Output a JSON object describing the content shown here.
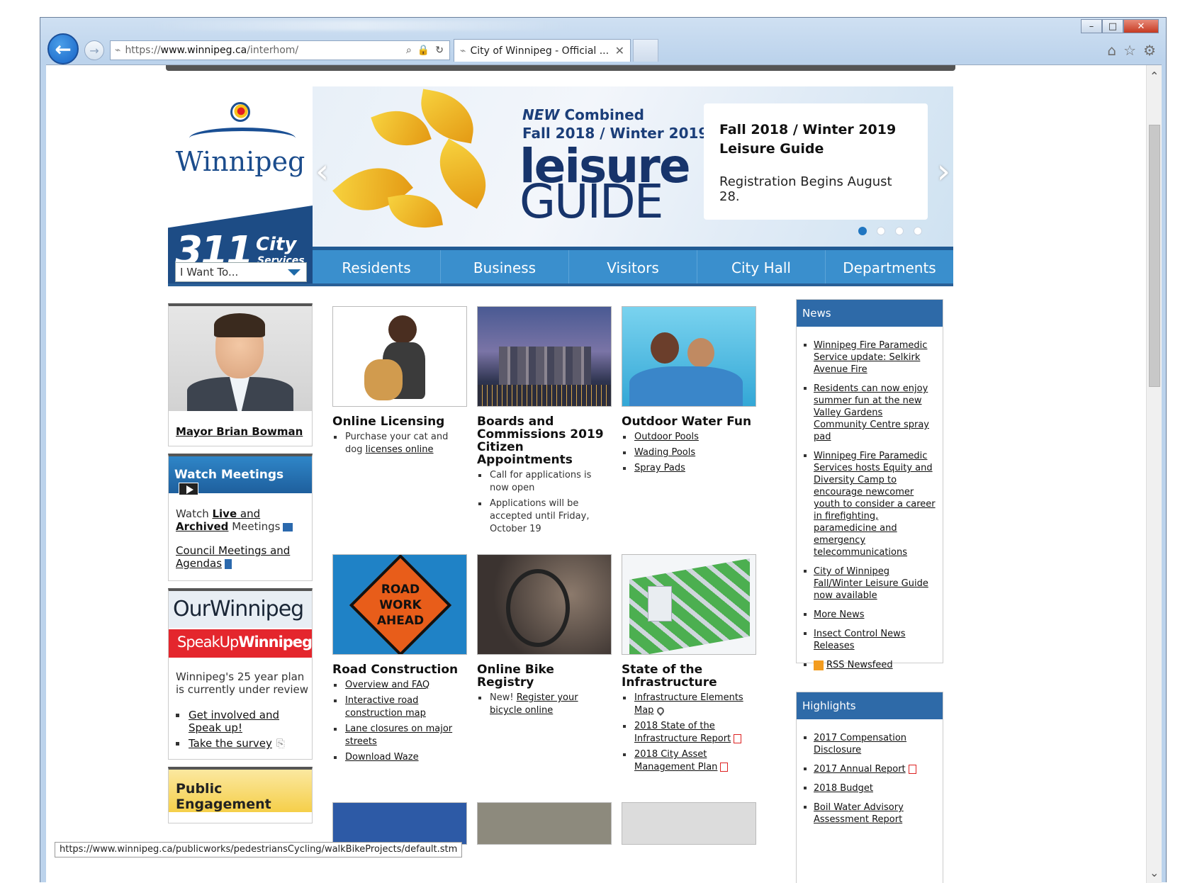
{
  "browser": {
    "address_prefix": "https://",
    "address_host": "www.winnipeg.ca",
    "address_path": "/interhom/",
    "tab_title": "City of Winnipeg - Official ...",
    "status_url": "https://www.winnipeg.ca/publicworks/pedestriansCycling/walkBikeProjects/default.stm"
  },
  "header": {
    "logo_word": "Winnipeg",
    "logo_311": "311",
    "logo_city": "City",
    "logo_services": "Services",
    "iwant_label": "I Want To..."
  },
  "hero": {
    "new_label": "NEW",
    "combined": "Combined",
    "season": "Fall 2018 / Winter 2019",
    "leisure": "leisure",
    "guide": "GUIDE",
    "card_title_line1": "Fall 2018 / Winter 2019",
    "card_title_line2": "Leisure Guide",
    "card_text": "Registration Begins August 28."
  },
  "nav": [
    "Residents",
    "Business",
    "Visitors",
    "City Hall",
    "Departments"
  ],
  "left": {
    "mayor_name": "Mayor Brian Bowman",
    "watch_title": "Watch Meetings",
    "watch_text_pre": "Watch ",
    "watch_live": "Live",
    "watch_and": " and",
    "watch_archived": "Archived",
    "watch_meetings": " Meetings",
    "council_link": "Council Meetings and Agendas",
    "our_winnipeg": "OurWinnipeg",
    "speakup": "SpeakUp",
    "speakup_w": "Winnipeg",
    "plan_text": "Winnipeg's 25 year plan is currently under review",
    "plan_links": [
      "Get involved and Speak up!",
      "Take the survey"
    ],
    "public_engagement": "Public Engagement"
  },
  "tiles": [
    {
      "title": "Online Licensing",
      "items": [
        {
          "pre": "Purchase your cat and dog ",
          "link": "licenses online"
        }
      ]
    },
    {
      "title": "Boards and Commissions 2019 Citizen Appointments",
      "items": [
        {
          "pre": "Call for applications is now open",
          "link": ""
        },
        {
          "pre": "Applications will be accepted until Friday, October 19",
          "link": ""
        }
      ]
    },
    {
      "title": "Outdoor Water Fun",
      "items": [
        {
          "pre": "",
          "link": "Outdoor Pools"
        },
        {
          "pre": "",
          "link": "Wading Pools"
        },
        {
          "pre": "",
          "link": "Spray Pads"
        }
      ]
    },
    {
      "title": "Road Construction",
      "items": [
        {
          "pre": "",
          "link": "Overview and FAQ"
        },
        {
          "pre": "",
          "link": "Interactive road construction map"
        },
        {
          "pre": "",
          "link": "Lane closures on major streets"
        },
        {
          "pre": "",
          "link": "Download Waze"
        }
      ],
      "sign": [
        "ROAD",
        "WORK",
        "AHEAD"
      ]
    },
    {
      "title": "Online Bike Registry",
      "items": [
        {
          "pre": "New! ",
          "link": "Register your bicycle online"
        }
      ]
    },
    {
      "title": "State of the Infrastructure",
      "items": [
        {
          "pre": "",
          "link": "Infrastructure Elements Map"
        },
        {
          "pre": "",
          "link": "2018 State of the Infrastructure Report"
        },
        {
          "pre": "",
          "link": "2018 City Asset Management Plan"
        }
      ]
    }
  ],
  "news": {
    "title": "News",
    "items": [
      "Winnipeg Fire Paramedic Service update: Selkirk Avenue Fire",
      "Residents can now enjoy summer fun at the new Valley Gardens Community Centre spray pad",
      "Winnipeg Fire Paramedic Services hosts Equity and Diversity Camp to encourage newcomer youth to consider a career in firefighting, paramedicine and emergency telecommunications",
      "City of Winnipeg Fall/Winter Leisure Guide now available",
      "More News",
      "Insect Control News Releases",
      "RSS Newsfeed"
    ]
  },
  "highlights": {
    "title": "Highlights",
    "items": [
      "2017 Compensation Disclosure",
      "2017 Annual Report",
      "2018 Budget",
      "Boil Water Advisory Assessment Report"
    ]
  },
  "colors": {
    "nav_blue": "#3a8fcd",
    "header_blue": "#1d4c85",
    "panel_blue": "#2e6aa8",
    "speakup_red": "#e4262d"
  }
}
